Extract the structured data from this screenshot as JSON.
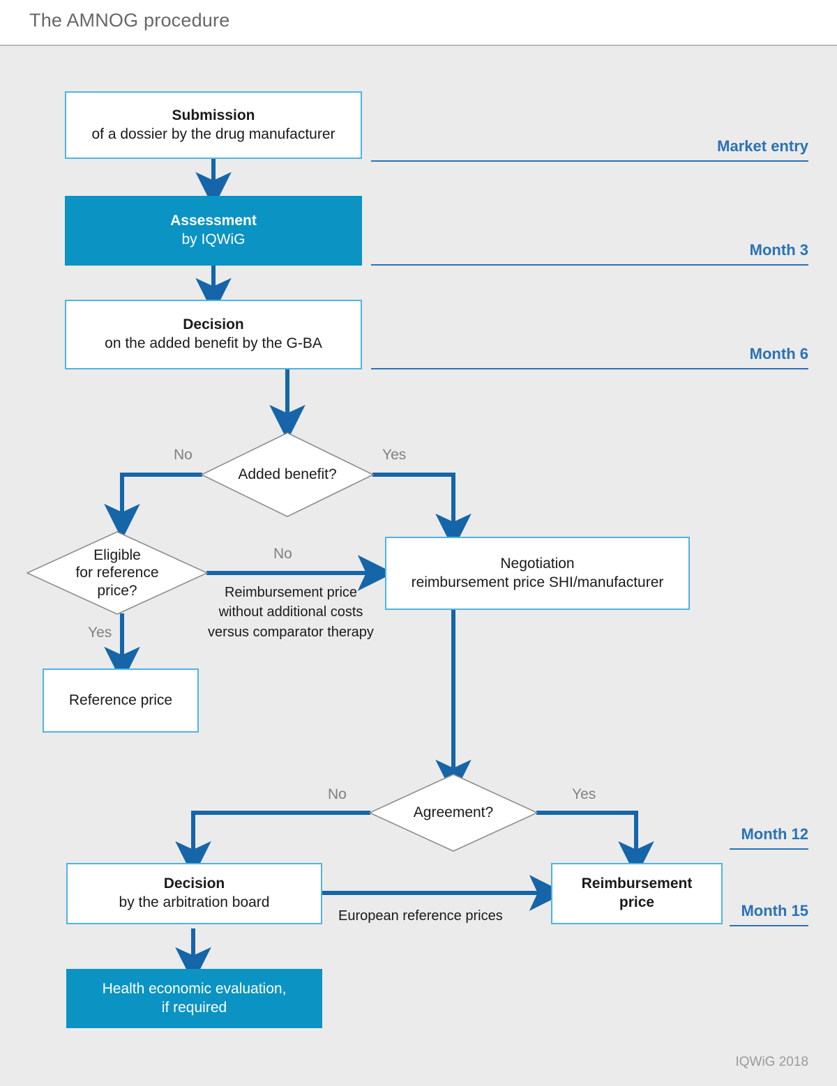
{
  "header": {
    "title": "The AMNOG procedure"
  },
  "footer": {
    "credit": "IQWiG 2018"
  },
  "colors": {
    "page_background": "#ebebeb",
    "header_background": "#ffffff",
    "box_border": "#4fb4e0",
    "box_fill_solid": "#0b93c4",
    "arrow": "#1565a8",
    "milestone": "#2a72b5",
    "label_gray": "#808080",
    "title_gray": "#676767"
  },
  "nodes": {
    "submission": {
      "title": "Submission",
      "subtitle": "of a dossier by the drug manufacturer"
    },
    "assessment": {
      "title": "Assessment",
      "subtitle": "by IQWiG"
    },
    "decision_gba": {
      "title": "Decision",
      "subtitle": "on the added benefit by the G-BA"
    },
    "negotiation": {
      "title": "Negotiation",
      "subtitle": "reimbursement price SHI/manufacturer"
    },
    "reference_price": {
      "title": "Reference price"
    },
    "decision_arbitration": {
      "title": "Decision",
      "subtitle": "by the arbitration board"
    },
    "reimbursement_price": {
      "title": "Reimbursement",
      "subtitle": "price"
    },
    "health_economic": {
      "title": "Health economic evaluation,",
      "subtitle": "if required"
    }
  },
  "decisions": {
    "added_benefit": {
      "label": "Added benefit?",
      "no": "No",
      "yes": "Yes"
    },
    "eligible_reference_price": {
      "line1": "Eligible",
      "line2": "for reference",
      "line3": "price?",
      "no": "No",
      "yes": "Yes"
    },
    "agreement": {
      "label": "Agreement?",
      "no": "No",
      "yes": "Yes"
    }
  },
  "edge_notes": {
    "reimbursement_without_extra_costs": {
      "line1": "Reimbursement price",
      "line2": "without additional costs",
      "line3": "versus comparator therapy"
    },
    "european_reference_prices": "European reference prices"
  },
  "milestones": [
    {
      "label": "Market entry"
    },
    {
      "label": "Month 3"
    },
    {
      "label": "Month 6"
    },
    {
      "label": "Month 12"
    },
    {
      "label": "Month 15"
    }
  ]
}
